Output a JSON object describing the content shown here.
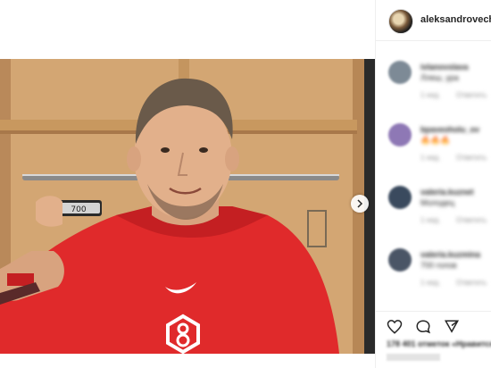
{
  "header": {
    "username": "aleksandrovechl"
  },
  "photo": {
    "puck_label": "700",
    "background_color": "#d3a673",
    "shirt_color": "#e02a2b"
  },
  "comments": [
    {
      "username": "ivlanovslava",
      "text": "Ллеш, ура",
      "time": "1 нед.",
      "reply": "Ответить",
      "avatar_color": "#7d8a96"
    },
    {
      "username": "bpaveoholu_ov",
      "text": "🔥🔥🔥",
      "time": "1 нед.",
      "reply": "Ответить",
      "avatar_color": "#8e78b5"
    },
    {
      "username": "valeria.kuznet",
      "text": "Молодец",
      "time": "1 нед.",
      "reply": "Ответить",
      "avatar_color": "#3a4a5e"
    },
    {
      "username": "valeria.kuzmina",
      "text": "700 голов",
      "time": "1 нед.",
      "reply": "Ответить",
      "avatar_color": "#4a5566"
    }
  ],
  "actions": {
    "likes_text": "178 401 отметок «Нравится»"
  }
}
